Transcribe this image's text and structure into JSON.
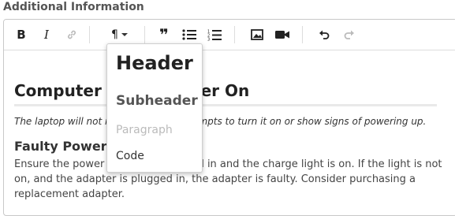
{
  "section_label": "Additional Information",
  "toolbar": {
    "bold": "B",
    "italic": "I",
    "paragraph_symbol": "¶",
    "quote": "❞",
    "buttons": [
      "bold-icon",
      "italic-icon",
      "link-icon",
      "paragraph-format-icon",
      "quote-icon",
      "bullet-list-icon",
      "numbered-list-icon",
      "image-icon",
      "video-icon",
      "undo-icon",
      "redo-icon"
    ]
  },
  "content": {
    "heading": "Computer Won't Power On",
    "lead": "The laptop will not respond to any attempts to turn it on or show signs of powering up.",
    "subheading": "Faulty Power Adapter",
    "paragraph": "Ensure the power adapter is plugged in and the charge light is on.  If the light is not on, and the adapter is plugged in, the adapter is faulty. Consider purchasing a replacement adapter."
  },
  "format_menu": {
    "header": "Header",
    "subheader": "Subheader",
    "paragraph": "Paragraph",
    "code": "Code"
  },
  "colors": {
    "accent_text": "#222222",
    "disabled": "#bbbbbb",
    "border": "#c8c8c8"
  }
}
